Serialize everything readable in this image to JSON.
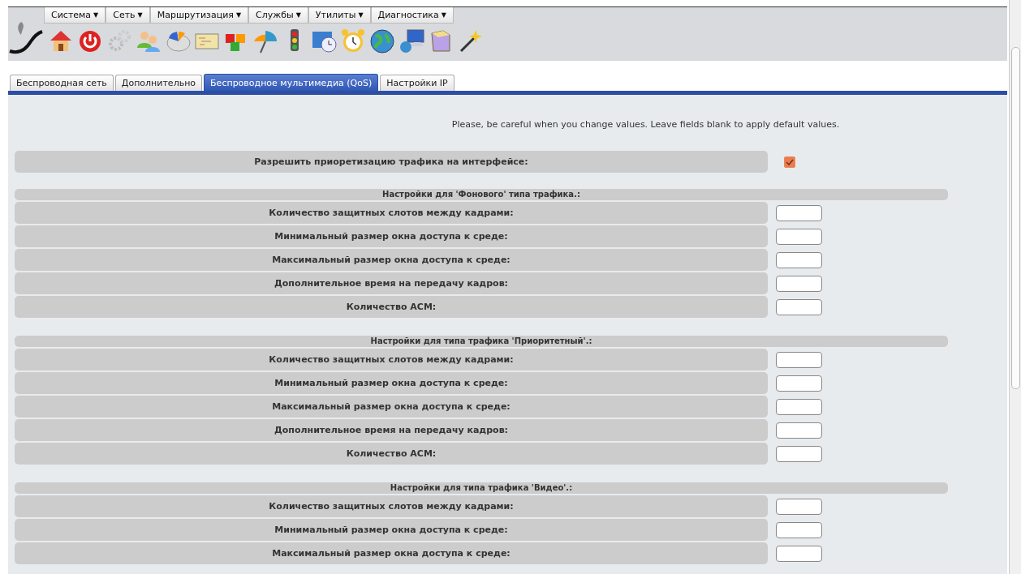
{
  "menu": [
    {
      "label": "Система",
      "caret": "▼"
    },
    {
      "label": "Сеть",
      "caret": "▼"
    },
    {
      "label": "Маршрутизация",
      "caret": "▼"
    },
    {
      "label": "Службы",
      "caret": "▼"
    },
    {
      "label": "Утилиты",
      "caret": "▼"
    },
    {
      "label": "Диагностика",
      "caret": "▼"
    }
  ],
  "tabs": [
    {
      "label": "Беспроводная сеть",
      "selected": false
    },
    {
      "label": "Дополнительно",
      "selected": false
    },
    {
      "label": "Беспроводное мультимедиа (QoS)",
      "selected": true
    },
    {
      "label": "Настройки IP",
      "selected": false
    }
  ],
  "notice": "Please, be careful when you change values. Leave fields blank to apply default values.",
  "enable_row": {
    "label": "Разрешить приоретизацию трафика на интерфейсе:",
    "checked": true
  },
  "sections": [
    {
      "title": "Настройки для 'Фонового' типа трафика.:",
      "fields": [
        "Количество защитных слотов между кадрами:",
        "Минимальный размер окна доступа к среде:",
        "Максимальный размер окна доступа к среде:",
        "Дополнительное время на передачу кадров:",
        "Количество ACM:"
      ]
    },
    {
      "title": "Настройки для типа трафика 'Приоритетный'.:",
      "fields": [
        "Количество защитных слотов между кадрами:",
        "Минимальный размер окна доступа к среде:",
        "Максимальный размер окна доступа к среде:",
        "Дополнительное время на передачу кадров:",
        "Количество ACM:"
      ]
    },
    {
      "title": "Настройки для типа трафика 'Видео'.:",
      "fields": [
        "Количество защитных слотов между кадрами:",
        "Минимальный размер окна доступа к среде:",
        "Максимальный размер окна доступа к среде:"
      ]
    }
  ]
}
